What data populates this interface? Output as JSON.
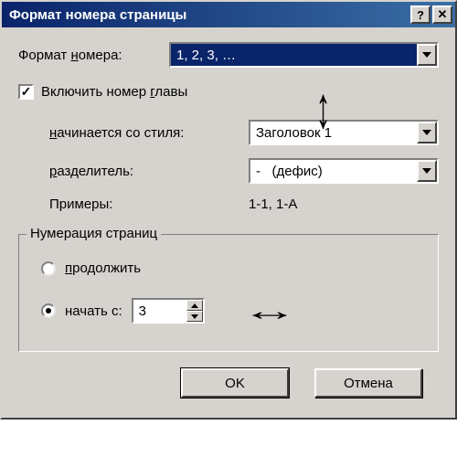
{
  "title": "Формат номера страницы",
  "format_label_pre": "Формат ",
  "format_label_u": "н",
  "format_label_post": "омера:",
  "format_value": "1, 2, 3, …",
  "include_chapter_pre": "Включить номер ",
  "include_chapter_u": "г",
  "include_chapter_post": "лавы",
  "starts_style_u": "н",
  "starts_style_post": "ачинается со стиля:",
  "starts_style_value": "Заголовок 1",
  "sep_u": "р",
  "sep_post": "азделитель:",
  "sep_value": "-   (дефис)",
  "examples_label": "Примеры:",
  "examples_value": "1-1, 1-A",
  "group_title": "Нумерация страниц",
  "radio_continue_u": "п",
  "radio_continue_post": "родолжить",
  "radio_start_u": "н",
  "radio_start_post": "ачать с:",
  "start_value": "3",
  "ok": "OK",
  "cancel": "Отмена",
  "help": "?",
  "close": "✕",
  "check": "✓",
  "arrow_v": "↕",
  "arrow_h": "↔"
}
